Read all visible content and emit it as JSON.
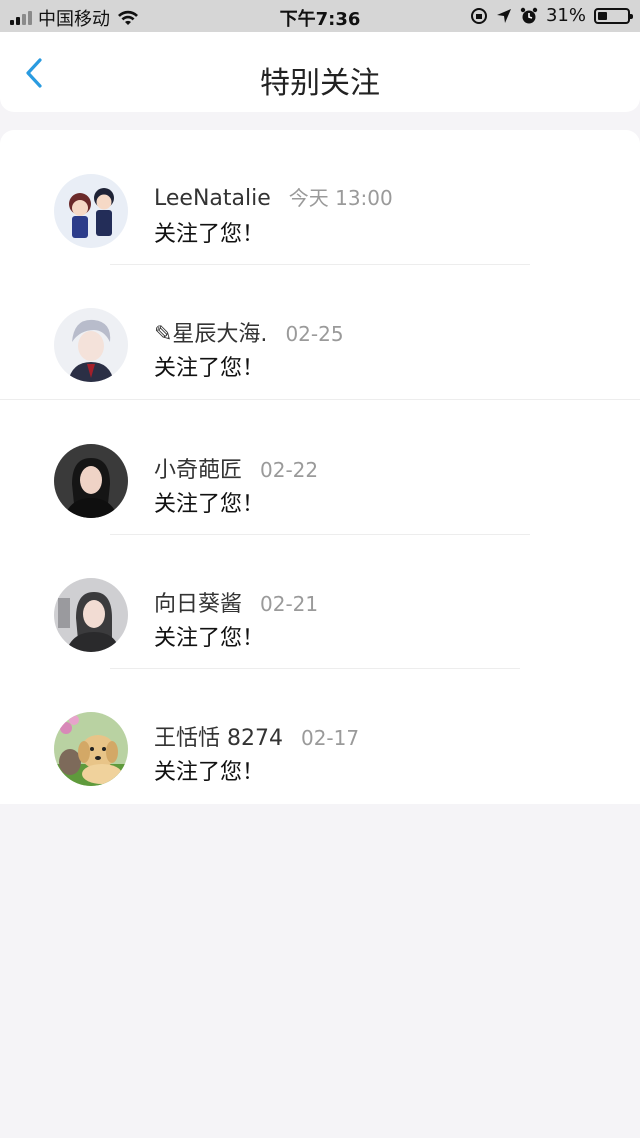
{
  "status_bar": {
    "carrier": "中国移动",
    "time": "下午7:36",
    "battery_text": "31%",
    "battery_level": 0.31
  },
  "nav": {
    "title": "特别关注",
    "accent_color": "#2a9be0"
  },
  "items": [
    {
      "name": "LeeNatalie",
      "time": "今天 13:00",
      "message": "关注了您！",
      "avatar": "cartoon-kids-avatar"
    },
    {
      "name": "✎星辰大海.",
      "time": "02-25",
      "message": "关注了您！",
      "avatar": "anime-boy-avatar"
    },
    {
      "name": "小奇葩匠",
      "time": "02-22",
      "message": "关注了您！",
      "avatar": "woman-portrait-avatar"
    },
    {
      "name": "向日葵酱",
      "time": "02-21",
      "message": "关注了您！",
      "avatar": "woman-dark-avatar"
    },
    {
      "name": "王恬恬 8274",
      "time": "02-17",
      "message": "关注了您！",
      "avatar": "puppy-avatar"
    }
  ]
}
